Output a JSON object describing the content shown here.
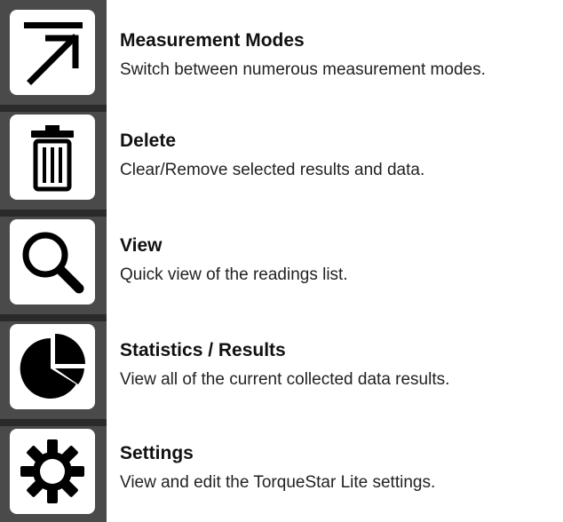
{
  "colors": {
    "sidebar": "#4a4a4a",
    "divider": "#2a2a2a",
    "icon": "#000000",
    "icon_background": "#ffffff"
  },
  "items": [
    {
      "icon": "measurement-modes-icon",
      "title": "Measurement Modes",
      "description": "Switch between numerous measurement modes."
    },
    {
      "icon": "trash-icon",
      "title": "Delete",
      "description": "Clear/Remove selected results and data."
    },
    {
      "icon": "magnifier-icon",
      "title": "View",
      "description": "Quick view of the readings list."
    },
    {
      "icon": "pie-chart-icon",
      "title": "Statistics / Results",
      "description": "View all of the current collected data results."
    },
    {
      "icon": "gear-icon",
      "title": "Settings",
      "description": "View and edit the TorqueStar Lite settings."
    }
  ]
}
